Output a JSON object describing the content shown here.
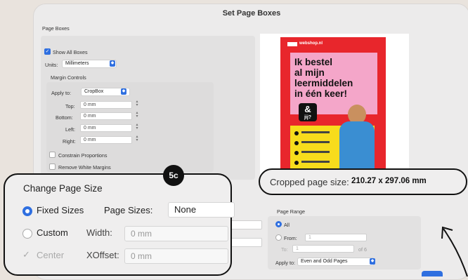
{
  "dialog": {
    "title": "Set Page Boxes"
  },
  "page_boxes": {
    "section_label": "Page Boxes",
    "show_all_boxes": {
      "label": "Show All Boxes",
      "checked": true
    },
    "units": {
      "label": "Units:",
      "value": "Millimeters"
    },
    "margin_controls": {
      "label": "Margin Controls",
      "apply_to": {
        "label": "Apply to:",
        "value": "CropBox"
      },
      "top": {
        "label": "Top:",
        "value": "0 mm"
      },
      "bottom": {
        "label": "Bottom:",
        "value": "0 mm"
      },
      "left": {
        "label": "Left:",
        "value": "0 mm"
      },
      "right": {
        "label": "Right:",
        "value": "0 mm"
      },
      "constrain_proportions": {
        "label": "Constrain Proportions",
        "checked": false
      },
      "remove_white_margins": {
        "label": "Remove White Margins",
        "checked": false
      }
    }
  },
  "preview": {
    "site": "webshop.nl",
    "headline": [
      "Ik bestel",
      "al mijn",
      "leermiddelen",
      "in één keer!"
    ],
    "bubble": "&",
    "bubble_sub": "jij?",
    "brand_color": "#e8262c",
    "headline_bg": "#f4a6c9"
  },
  "change_page_size": {
    "title": "Change Page Size",
    "fixed_sizes": {
      "label": "Fixed Sizes",
      "selected": true
    },
    "page_sizes": {
      "label": "Page Sizes:",
      "value": "None"
    },
    "custom": {
      "label": "Custom",
      "selected": false
    },
    "width": {
      "label": "Width:",
      "value": "0 mm"
    },
    "center": {
      "label": "Center",
      "checked": true
    },
    "xoffset": {
      "label": "XOffset:",
      "value": "0 mm"
    }
  },
  "badge": {
    "label": "5c"
  },
  "cropped": {
    "label": "Cropped page size:",
    "value": "210.27 x 297.06 mm"
  },
  "page_range": {
    "label": "Page Range",
    "all": {
      "label": "All",
      "selected": true
    },
    "from": {
      "label": "From:",
      "value": "1"
    },
    "to": {
      "label": "To:",
      "value": "1",
      "of": "of 6"
    },
    "apply_to": {
      "label": "Apply to:",
      "value": "Even and Odd Pages"
    }
  },
  "accent_color": "#2f6fe0"
}
